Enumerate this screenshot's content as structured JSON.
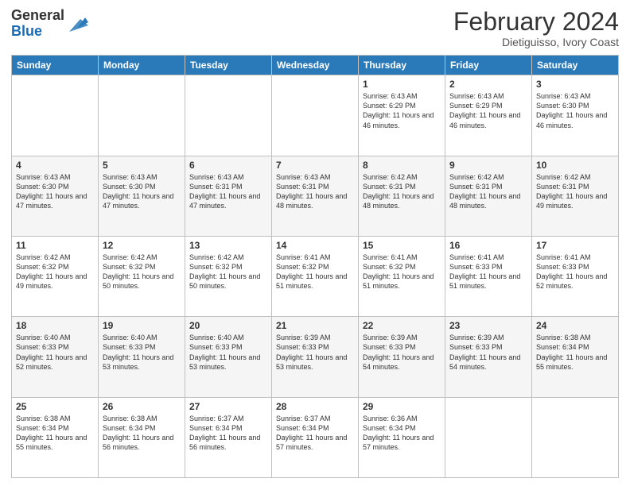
{
  "header": {
    "logo_line1": "General",
    "logo_line2": "Blue",
    "title": "February 2024",
    "subtitle": "Dietiguisso, Ivory Coast"
  },
  "days_of_week": [
    "Sunday",
    "Monday",
    "Tuesday",
    "Wednesday",
    "Thursday",
    "Friday",
    "Saturday"
  ],
  "weeks": [
    [
      {
        "day": "",
        "info": ""
      },
      {
        "day": "",
        "info": ""
      },
      {
        "day": "",
        "info": ""
      },
      {
        "day": "",
        "info": ""
      },
      {
        "day": "1",
        "info": "Sunrise: 6:43 AM\nSunset: 6:29 PM\nDaylight: 11 hours and 46 minutes."
      },
      {
        "day": "2",
        "info": "Sunrise: 6:43 AM\nSunset: 6:29 PM\nDaylight: 11 hours and 46 minutes."
      },
      {
        "day": "3",
        "info": "Sunrise: 6:43 AM\nSunset: 6:30 PM\nDaylight: 11 hours and 46 minutes."
      }
    ],
    [
      {
        "day": "4",
        "info": "Sunrise: 6:43 AM\nSunset: 6:30 PM\nDaylight: 11 hours and 47 minutes."
      },
      {
        "day": "5",
        "info": "Sunrise: 6:43 AM\nSunset: 6:30 PM\nDaylight: 11 hours and 47 minutes."
      },
      {
        "day": "6",
        "info": "Sunrise: 6:43 AM\nSunset: 6:31 PM\nDaylight: 11 hours and 47 minutes."
      },
      {
        "day": "7",
        "info": "Sunrise: 6:43 AM\nSunset: 6:31 PM\nDaylight: 11 hours and 48 minutes."
      },
      {
        "day": "8",
        "info": "Sunrise: 6:42 AM\nSunset: 6:31 PM\nDaylight: 11 hours and 48 minutes."
      },
      {
        "day": "9",
        "info": "Sunrise: 6:42 AM\nSunset: 6:31 PM\nDaylight: 11 hours and 48 minutes."
      },
      {
        "day": "10",
        "info": "Sunrise: 6:42 AM\nSunset: 6:31 PM\nDaylight: 11 hours and 49 minutes."
      }
    ],
    [
      {
        "day": "11",
        "info": "Sunrise: 6:42 AM\nSunset: 6:32 PM\nDaylight: 11 hours and 49 minutes."
      },
      {
        "day": "12",
        "info": "Sunrise: 6:42 AM\nSunset: 6:32 PM\nDaylight: 11 hours and 50 minutes."
      },
      {
        "day": "13",
        "info": "Sunrise: 6:42 AM\nSunset: 6:32 PM\nDaylight: 11 hours and 50 minutes."
      },
      {
        "day": "14",
        "info": "Sunrise: 6:41 AM\nSunset: 6:32 PM\nDaylight: 11 hours and 51 minutes."
      },
      {
        "day": "15",
        "info": "Sunrise: 6:41 AM\nSunset: 6:32 PM\nDaylight: 11 hours and 51 minutes."
      },
      {
        "day": "16",
        "info": "Sunrise: 6:41 AM\nSunset: 6:33 PM\nDaylight: 11 hours and 51 minutes."
      },
      {
        "day": "17",
        "info": "Sunrise: 6:41 AM\nSunset: 6:33 PM\nDaylight: 11 hours and 52 minutes."
      }
    ],
    [
      {
        "day": "18",
        "info": "Sunrise: 6:40 AM\nSunset: 6:33 PM\nDaylight: 11 hours and 52 minutes."
      },
      {
        "day": "19",
        "info": "Sunrise: 6:40 AM\nSunset: 6:33 PM\nDaylight: 11 hours and 53 minutes."
      },
      {
        "day": "20",
        "info": "Sunrise: 6:40 AM\nSunset: 6:33 PM\nDaylight: 11 hours and 53 minutes."
      },
      {
        "day": "21",
        "info": "Sunrise: 6:39 AM\nSunset: 6:33 PM\nDaylight: 11 hours and 53 minutes."
      },
      {
        "day": "22",
        "info": "Sunrise: 6:39 AM\nSunset: 6:33 PM\nDaylight: 11 hours and 54 minutes."
      },
      {
        "day": "23",
        "info": "Sunrise: 6:39 AM\nSunset: 6:33 PM\nDaylight: 11 hours and 54 minutes."
      },
      {
        "day": "24",
        "info": "Sunrise: 6:38 AM\nSunset: 6:34 PM\nDaylight: 11 hours and 55 minutes."
      }
    ],
    [
      {
        "day": "25",
        "info": "Sunrise: 6:38 AM\nSunset: 6:34 PM\nDaylight: 11 hours and 55 minutes."
      },
      {
        "day": "26",
        "info": "Sunrise: 6:38 AM\nSunset: 6:34 PM\nDaylight: 11 hours and 56 minutes."
      },
      {
        "day": "27",
        "info": "Sunrise: 6:37 AM\nSunset: 6:34 PM\nDaylight: 11 hours and 56 minutes."
      },
      {
        "day": "28",
        "info": "Sunrise: 6:37 AM\nSunset: 6:34 PM\nDaylight: 11 hours and 57 minutes."
      },
      {
        "day": "29",
        "info": "Sunrise: 6:36 AM\nSunset: 6:34 PM\nDaylight: 11 hours and 57 minutes."
      },
      {
        "day": "",
        "info": ""
      },
      {
        "day": "",
        "info": ""
      }
    ]
  ]
}
